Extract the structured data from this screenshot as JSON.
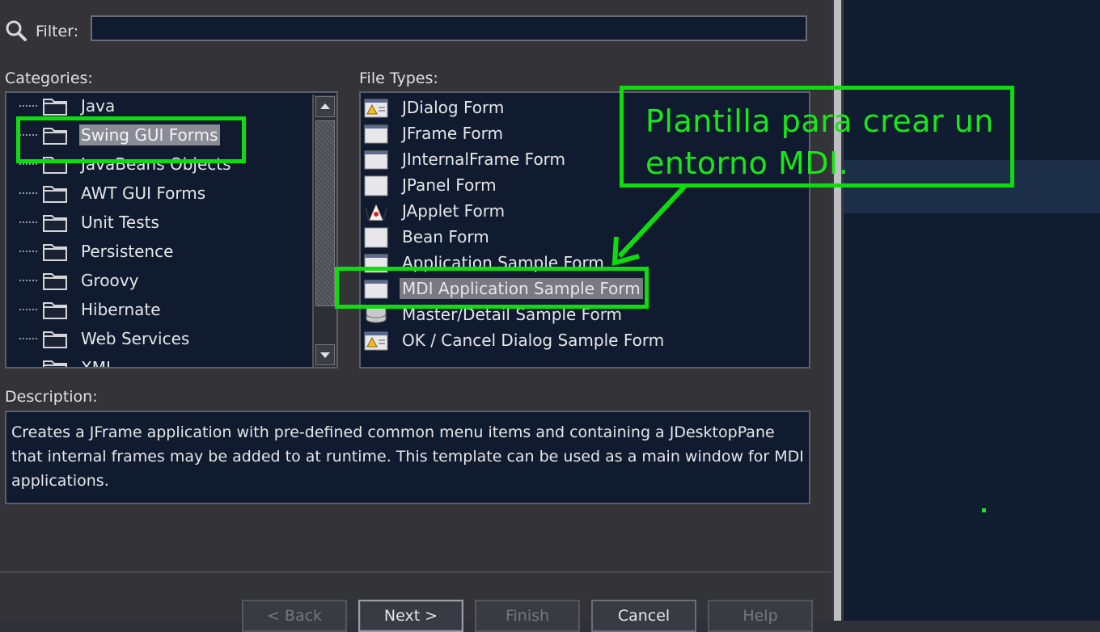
{
  "filter": {
    "label": "Filter:",
    "value": ""
  },
  "categories": {
    "label": "Categories:",
    "items": [
      {
        "label": "Java",
        "selected": false
      },
      {
        "label": "Swing GUI Forms",
        "selected": true
      },
      {
        "label": "JavaBeans Objects",
        "selected": false
      },
      {
        "label": "AWT GUI Forms",
        "selected": false
      },
      {
        "label": "Unit Tests",
        "selected": false
      },
      {
        "label": "Persistence",
        "selected": false
      },
      {
        "label": "Groovy",
        "selected": false
      },
      {
        "label": "Hibernate",
        "selected": false
      },
      {
        "label": "Web Services",
        "selected": false
      },
      {
        "label": "XML",
        "selected": false
      }
    ]
  },
  "file_types": {
    "label": "File Types:",
    "items": [
      {
        "label": "JDialog Form",
        "icon": "dialog-warning-icon"
      },
      {
        "label": "JFrame Form",
        "icon": "frame-icon"
      },
      {
        "label": "JInternalFrame Form",
        "icon": "frame-icon"
      },
      {
        "label": "JPanel Form",
        "icon": "panel-icon"
      },
      {
        "label": "JApplet Form",
        "icon": "applet-duke-icon"
      },
      {
        "label": "Bean Form",
        "icon": "panel-icon"
      },
      {
        "label": "Application Sample Form",
        "icon": "frame-icon"
      },
      {
        "label": "MDI Application Sample Form",
        "icon": "frame-icon",
        "selected": true
      },
      {
        "label": "Master/Detail Sample Form",
        "icon": "database-icon"
      },
      {
        "label": "OK / Cancel Dialog Sample Form",
        "icon": "dialog-warning-icon"
      }
    ]
  },
  "description": {
    "label": "Description:",
    "text": "Creates a JFrame application with pre-defined common menu items and containing a JDesktopPane that internal frames may be added to at runtime. This template can be used as a main window for MDI applications."
  },
  "buttons": {
    "back": "< Back",
    "next": "Next >",
    "finish": "Finish",
    "cancel": "Cancel",
    "help": "Help"
  },
  "annotation": {
    "line1": "Plantilla para crear un",
    "line2": "entorno MDI.",
    "color": "#18e818"
  }
}
